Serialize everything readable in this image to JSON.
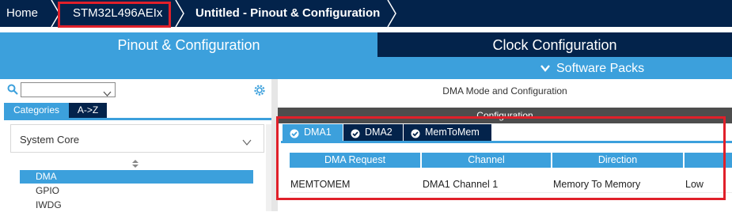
{
  "breadcrumb": {
    "home": "Home",
    "mcu": "STM32L496AEIx",
    "project": "Untitled - Pinout & Configuration"
  },
  "main_tabs": {
    "pinout": "Pinout & Configuration",
    "clock": "Clock Configuration"
  },
  "software_packs": "Software Packs",
  "left_panel": {
    "search_value": "",
    "tabs": {
      "categories": "Categories",
      "az": "A->Z"
    },
    "section": "System Core",
    "items": [
      {
        "label": "DMA",
        "selected": true
      },
      {
        "label": "GPIO",
        "selected": false
      },
      {
        "label": "IWDG",
        "selected": false
      }
    ]
  },
  "right_panel": {
    "title": "DMA Mode and Configuration",
    "config_header": "Configuration",
    "tabs": [
      "DMA1",
      "DMA2",
      "MemToMem"
    ],
    "table": {
      "headers": [
        "DMA Request",
        "Channel",
        "Direction",
        ""
      ],
      "rows": [
        [
          "MEMTOMEM",
          "DMA1 Channel 1",
          "Memory To Memory",
          "Low"
        ]
      ]
    }
  },
  "colors": {
    "navy": "#03234b",
    "accent_blue": "#3ca0dc",
    "highlight_red": "#e0202a"
  }
}
